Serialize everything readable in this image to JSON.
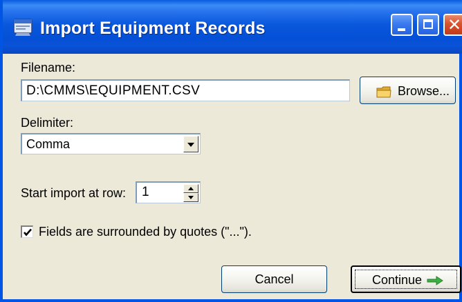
{
  "window": {
    "title": "Import Equipment Records",
    "controls": {
      "minimize": "minimize",
      "maximize": "maximize",
      "close": "close"
    }
  },
  "filename": {
    "label": "Filename:",
    "value": "D:\\CMMS\\EQUIPMENT.CSV",
    "browse_label": "Browse..."
  },
  "delimiter": {
    "label": "Delimiter:",
    "selected": "Comma"
  },
  "start_row": {
    "label": "Start import at row:",
    "value": "1"
  },
  "quotes": {
    "label": "Fields are surrounded by quotes (\"...\").",
    "checked": true
  },
  "buttons": {
    "cancel": "Cancel",
    "continue": "Continue"
  },
  "icons": {
    "app": "app-window-icon",
    "folder": "folder-icon",
    "arrow": "right-arrow-icon",
    "check": "checkmark-icon"
  },
  "colors": {
    "titlebar": "#0a58dd",
    "dialog_bg": "#ece9d8",
    "close_button": "#d8532e",
    "arrow_green": "#3cb043",
    "folder_yellow": "#f0c850"
  }
}
